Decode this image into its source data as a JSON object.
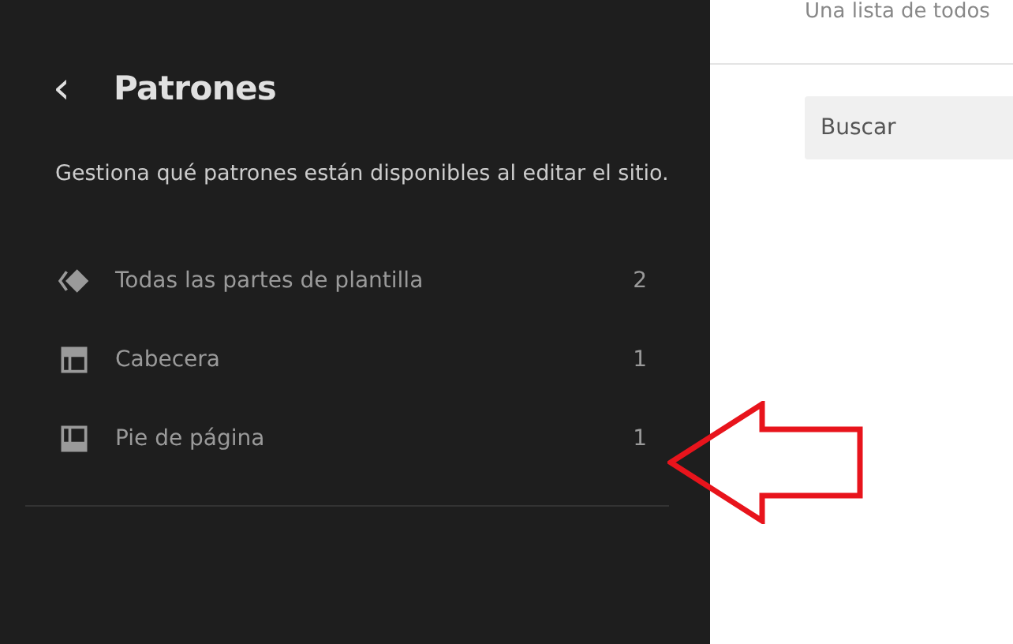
{
  "sidebar": {
    "back": "‹",
    "title": "Patrones",
    "description": "Gestiona qué patrones están disponibles al editar el sitio.",
    "items": [
      {
        "kind": "all",
        "label": "Todas las partes de plantilla",
        "count": "2"
      },
      {
        "kind": "header",
        "label": "Cabecera",
        "count": "1"
      },
      {
        "kind": "footer",
        "label": "Pie de página",
        "count": "1"
      }
    ]
  },
  "main": {
    "intro": "Una lista de todos",
    "search": {
      "placeholder": "Buscar"
    }
  },
  "annotation": {
    "kind": "arrow-left"
  }
}
